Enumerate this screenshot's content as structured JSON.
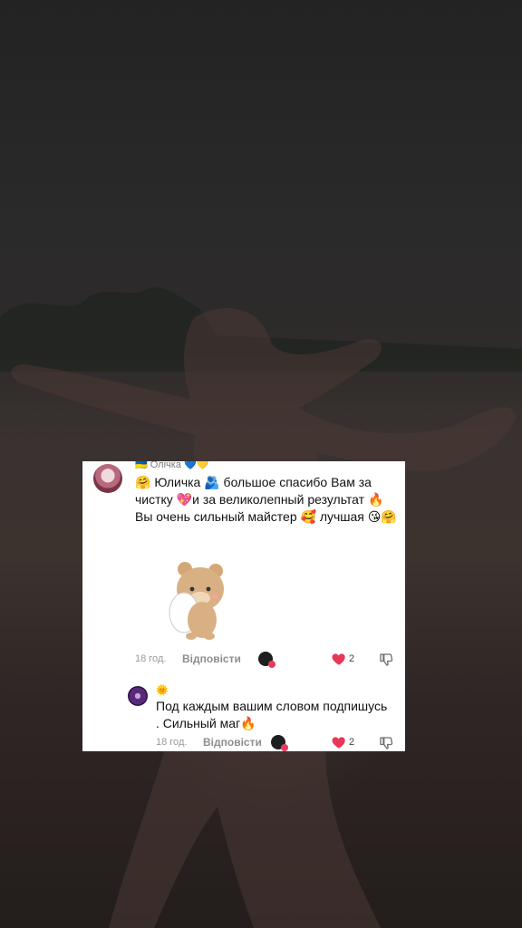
{
  "comment": {
    "username": "🇺🇦 Олічка 💙💛",
    "text": "🤗 Юличка 🫂 большое спасибо Вам за чистку 💖и за великолепный результат 🔥 Вы очень сильный майстер 🥰 лучшая 😘🤗",
    "time": "18 год.",
    "reply_label": "Відповісти",
    "likes": "2"
  },
  "reply": {
    "username": "🌞",
    "text": "Под каждым вашим словом подпишусь . Сильный маг🔥",
    "time": "18 год.",
    "reply_label": "Відповісти",
    "likes": "2"
  },
  "colors": {
    "like": "#e8385a",
    "muted": "#9a9a9a",
    "card": "#ffffff"
  },
  "icons": {
    "like": "heart-icon",
    "dislike": "thumbs-down-icon",
    "creator": "creator-liked-badge-icon",
    "sticker": "bear-hug-sticker"
  }
}
